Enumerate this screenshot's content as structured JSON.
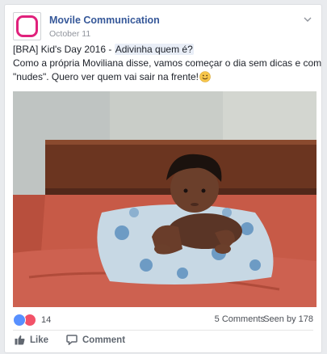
{
  "post": {
    "author": "Movile Communication",
    "date": "October 11",
    "text_line1_before": "[BRA] Kid's Day 2016 - ",
    "text_line1_highlight": "Adivinha quem é?",
    "text_line2": "Como a própria Moviliana disse, vamos começar o dia sem dicas e com",
    "text_line3": "\"nudes\". Quero ver quem vai sair na frente!"
  },
  "stats": {
    "reaction_count": "14",
    "comments": "5 Comments",
    "seen": "Seen by 178"
  },
  "actions": {
    "like_label": "Like",
    "comment_label": "Comment"
  },
  "icons": {
    "avatar": "movile-logo-icon",
    "menu": "chevron-down-icon",
    "reactions": [
      "like-reaction-icon",
      "love-reaction-icon"
    ],
    "emoji": "smiley-emoji-icon"
  },
  "colors": {
    "brand_pink": "#e0217c",
    "link_blue": "#365899",
    "like_blue": "#5890ff",
    "love_red": "#f25268"
  }
}
